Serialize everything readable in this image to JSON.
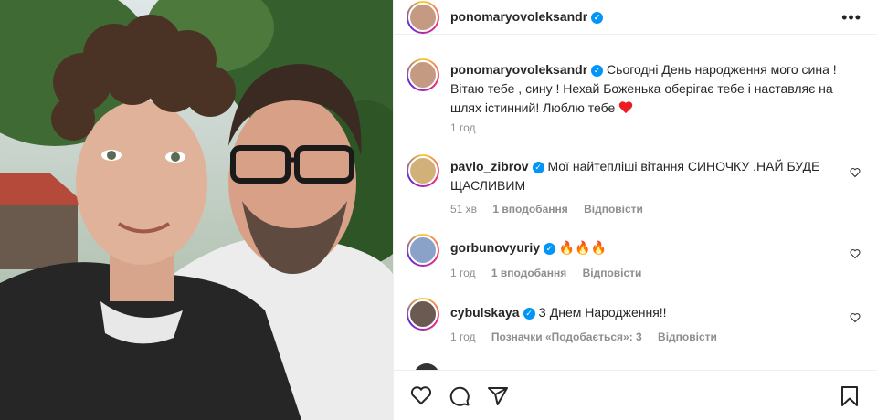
{
  "post": {
    "author": "ponomaryovoleksandr",
    "caption": "Сьогодні День народження мого сина ! Вітаю тебе , сину ! Нехай Боженька оберігає тебе і наставляє на шлях істинний! Люблю тебе",
    "time": "1 год"
  },
  "comments": [
    {
      "user": "pavlo_zibrov",
      "text": "Мої найтепліші вітання СИНОЧКУ .НАЙ БУДЕ ЩАСЛИВИМ",
      "time": "51 хв",
      "likes": "1 вподобання",
      "reply": "Відповісти"
    },
    {
      "user": "gorbunovyuriy",
      "text": "🔥🔥🔥",
      "time": "1 год",
      "likes": "1 вподобання",
      "reply": "Відповісти"
    },
    {
      "user": "cybulskaya",
      "text": "З Днем Народження!!",
      "time": "1 год",
      "likes": "Позначки «Подобається»: 3",
      "reply": "Відповісти"
    }
  ],
  "icons": {
    "verified": "verified-badge-icon",
    "more": "more-options-icon",
    "like": "heart-icon",
    "comment": "comment-icon",
    "share": "share-icon",
    "save": "bookmark-icon"
  },
  "colors": {
    "verified": "#0095f6",
    "heart_red": "#ed1c24",
    "muted_text": "#8e8e8e"
  }
}
